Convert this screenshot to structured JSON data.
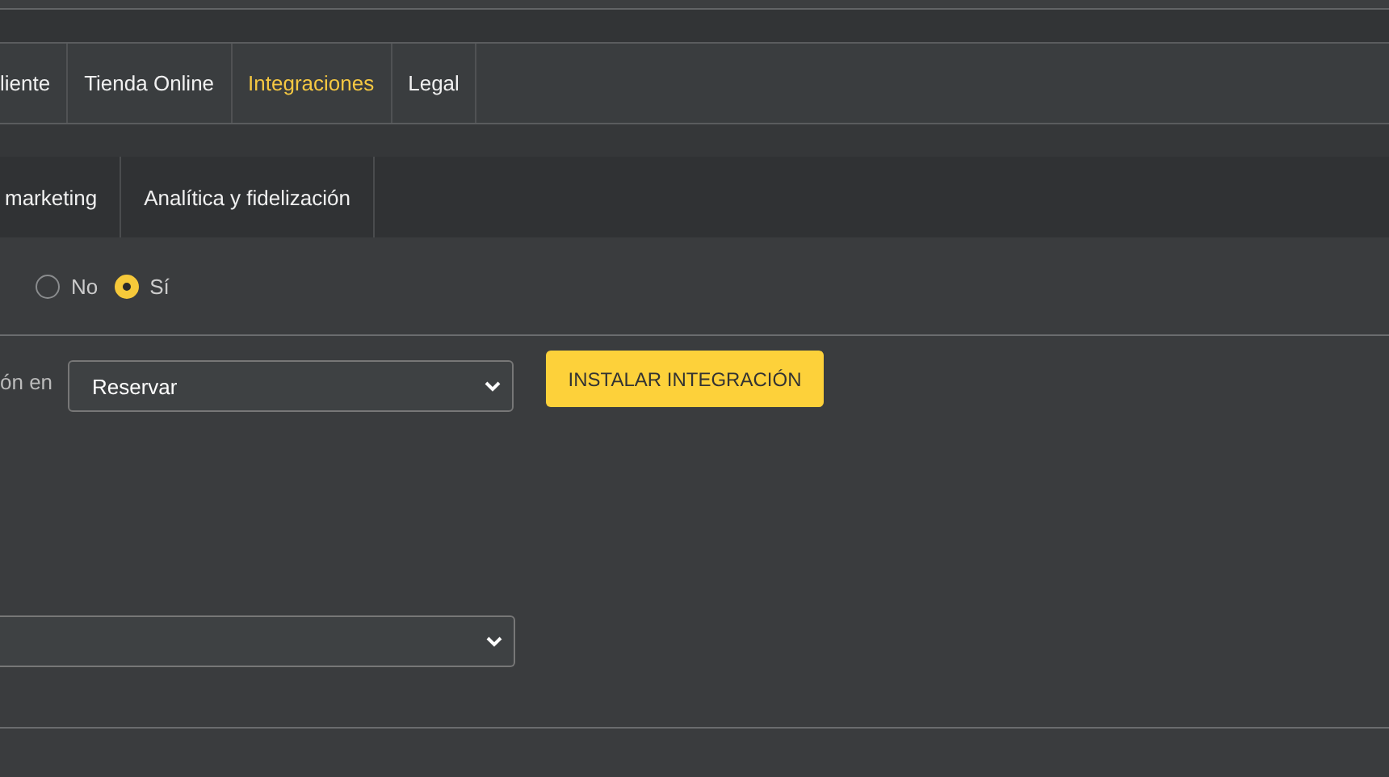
{
  "tabs": [
    {
      "label": "liente",
      "selected": false
    },
    {
      "label": "Tienda Online",
      "selected": false
    },
    {
      "label": "Integraciones",
      "selected": true
    },
    {
      "label": "Legal",
      "selected": false
    }
  ],
  "subtabs": [
    {
      "label": "marketing",
      "selected": false
    },
    {
      "label": "Analítica y fidelización",
      "selected": false
    }
  ],
  "radios": [
    {
      "label": "No",
      "selected": false
    },
    {
      "label": "Sí",
      "selected": true
    }
  ],
  "install": {
    "label": "ón en",
    "select_value": "Reservar",
    "button": "INSTALAR INTEGRACIÓN"
  },
  "second_select": {
    "kind": "dropdown"
  }
}
